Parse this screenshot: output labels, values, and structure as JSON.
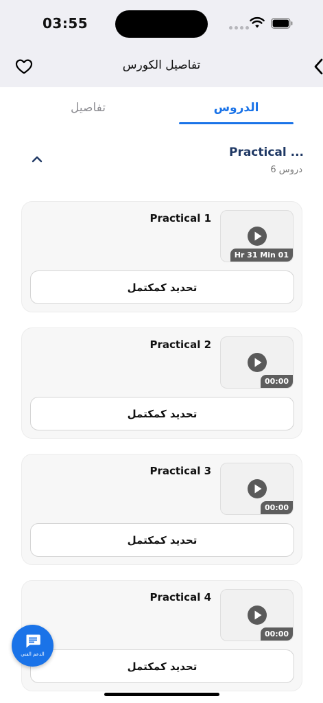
{
  "status_bar": {
    "time": "03:55"
  },
  "nav": {
    "title": "تفاصيل الكورس"
  },
  "tabs": {
    "lessons": "الدروس",
    "details": "تفاصيل"
  },
  "section": {
    "title": "Practical ...",
    "count": "6 دروس"
  },
  "lessons": [
    {
      "title": "Practical 1",
      "duration": "Hr 31 Min 01",
      "action": "تحديد كمكتمل"
    },
    {
      "title": "Practical 2",
      "duration": "00:00",
      "action": "تحديد كمكتمل"
    },
    {
      "title": "Practical 3",
      "duration": "00:00",
      "action": "تحديد كمكتمل"
    },
    {
      "title": "Practical 4",
      "duration": "00:00",
      "action": "تحديد كمكتمل"
    }
  ],
  "support": {
    "label": "الدعم الفني"
  },
  "colors": {
    "accent": "#1a73e8",
    "section_title": "#1f3864",
    "badge": "#5e5e5e",
    "background_top": "#efeff4"
  },
  "icons": {
    "favorite": "heart-icon",
    "back": "chevron-right-icon",
    "collapse": "chevron-up-icon",
    "play": "play-icon",
    "support": "chat-icon"
  }
}
